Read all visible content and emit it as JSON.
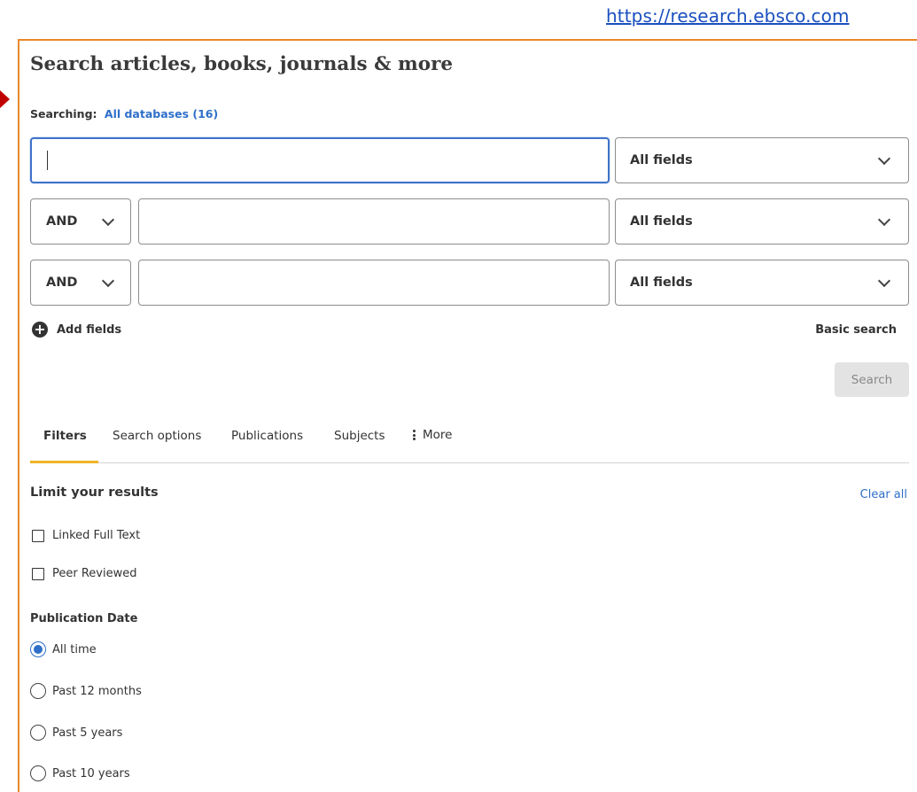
{
  "url_label": "https://research.ebsco.com",
  "header": {
    "title": "Search articles, books, journals & more",
    "searching_label": "Searching:",
    "databases_link": "All databases (16)"
  },
  "search_rows": [
    {
      "boolean": "",
      "query_value": "",
      "field": "All fields"
    },
    {
      "boolean": "AND",
      "query_value": "",
      "field": "All fields"
    },
    {
      "boolean": "AND",
      "query_value": "",
      "field": "All fields"
    }
  ],
  "actions": {
    "add_fields": "Add fields",
    "basic_search": "Basic search",
    "search_button": "Search"
  },
  "tabs": [
    {
      "label": "Filters",
      "active": true
    },
    {
      "label": "Search options"
    },
    {
      "label": "Publications"
    },
    {
      "label": "Subjects"
    },
    {
      "label": "More"
    }
  ],
  "filters": {
    "title": "Limit your results",
    "clear_all": "Clear all",
    "checkboxes": [
      {
        "label": "Linked Full Text",
        "checked": false
      },
      {
        "label": "Peer Reviewed",
        "checked": false
      }
    ],
    "publication_date_title": "Publication Date",
    "date_options": [
      {
        "label": "All time",
        "selected": true
      },
      {
        "label": "Past 12 months",
        "selected": false
      },
      {
        "label": "Past 5 years",
        "selected": false
      },
      {
        "label": "Past 10 years",
        "selected": false
      }
    ]
  },
  "colors": {
    "frame": "#e8882a",
    "pointer_arrow": "#c00000",
    "accent_link": "#2f6fc9",
    "focus_border": "#3f73c9",
    "tab_underline": "#f0b429"
  }
}
